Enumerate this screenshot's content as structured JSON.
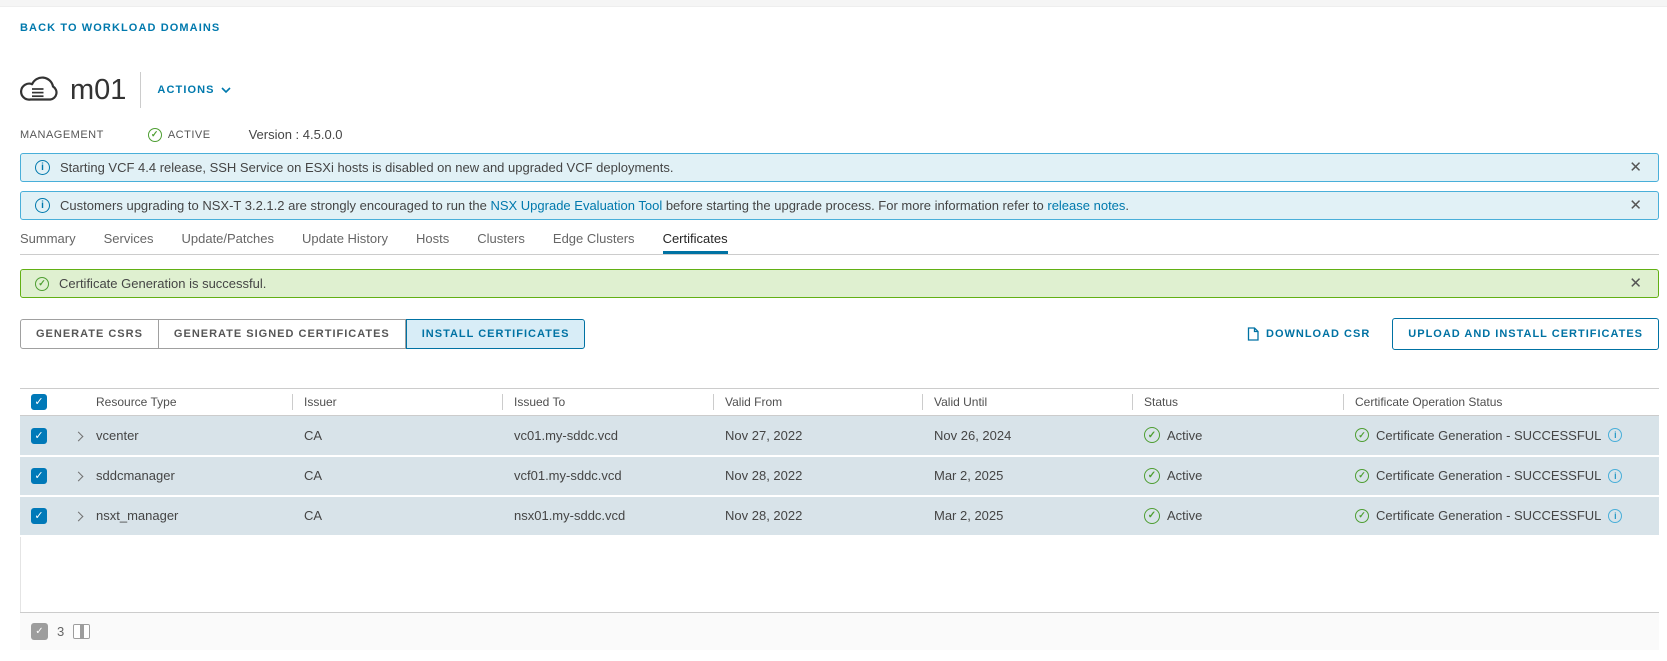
{
  "header": {
    "back_link": "BACK TO WORKLOAD DOMAINS",
    "domain_name": "m01",
    "actions_label": "ACTIONS",
    "type_label": "MANAGEMENT",
    "status_label": "ACTIVE",
    "version_label": "Version : 4.5.0.0"
  },
  "banners": {
    "ssh_notice": "Starting VCF 4.4 release, SSH Service on ESXi hosts is disabled on new and upgraded VCF deployments.",
    "nsx_notice": {
      "text_before": "Customers upgrading to NSX-T 3.2.1.2 are strongly encouraged to run the ",
      "link1": "NSX Upgrade Evaluation Tool",
      "text_middle": " before starting the upgrade process. For more information refer to ",
      "link2": "release notes",
      "text_after": "."
    },
    "success_notice": "Certificate Generation is successful.",
    "close_glyph": "✕"
  },
  "tabs": [
    {
      "label": "Summary"
    },
    {
      "label": "Services"
    },
    {
      "label": "Update/Patches"
    },
    {
      "label": "Update History"
    },
    {
      "label": "Hosts"
    },
    {
      "label": "Clusters"
    },
    {
      "label": "Edge Clusters"
    },
    {
      "label": "Certificates"
    }
  ],
  "toolbar": {
    "generate_csrs": "GENERATE CSRS",
    "generate_signed": "GENERATE SIGNED CERTIFICATES",
    "install": "INSTALL CERTIFICATES",
    "download_csr": "DOWNLOAD CSR",
    "upload_install": "UPLOAD AND INSTALL CERTIFICATES"
  },
  "table": {
    "columns": [
      "Resource Type",
      "Issuer",
      "Issued To",
      "Valid From",
      "Valid Until",
      "Status",
      "Certificate Operation Status"
    ],
    "rows": [
      {
        "resource_type": "vcenter",
        "issuer": "CA",
        "issued_to": "vc01.my-sddc.vcd",
        "valid_from": "Nov 27, 2022",
        "valid_until": "Nov 26, 2024",
        "status": "Active",
        "operation_status": "Certificate Generation - SUCCESSFUL"
      },
      {
        "resource_type": "sddcmanager",
        "issuer": "CA",
        "issued_to": "vcf01.my-sddc.vcd",
        "valid_from": "Nov 28, 2022",
        "valid_until": "Mar 2, 2025",
        "status": "Active",
        "operation_status": "Certificate Generation - SUCCESSFUL"
      },
      {
        "resource_type": "nsxt_manager",
        "issuer": "CA",
        "issued_to": "nsx01.my-sddc.vcd",
        "valid_from": "Nov 28, 2022",
        "valid_until": "Mar 2, 2025",
        "status": "Active",
        "operation_status": "Certificate Generation - SUCCESSFUL"
      }
    ],
    "footer": {
      "selected_count": "3"
    }
  },
  "glyphs": {
    "check": "✓",
    "info": "i"
  },
  "colors": {
    "action_blue": "#0072a3",
    "link_blue": "#0079ad",
    "info_banner_bg": "#e1f1f6",
    "info_banner_border": "#49afd9",
    "success_banner_bg": "#dff0d0",
    "success_banner_border": "#62b014",
    "success_green": "#4e9e32",
    "selected_row_bg": "#d8e3e9",
    "checkbox_blue": "#0079b8"
  }
}
